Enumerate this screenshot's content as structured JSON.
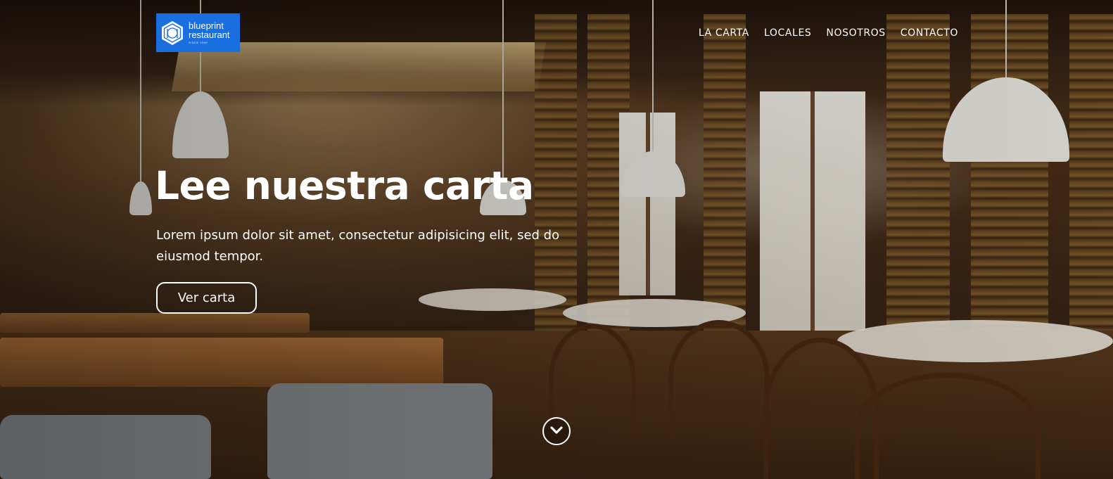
{
  "header": {
    "logo": {
      "line1": "blueprint",
      "line2": "restaurant",
      "line3": "SINCE 1990",
      "color": "#1a6fe0"
    },
    "nav": [
      "LA CARTA",
      "LOCALES",
      "NOSOTROS",
      "CONTACTO"
    ]
  },
  "hero": {
    "title": "Lee nuestra carta",
    "subtitle": "Lorem ipsum dolor sit amet, consectetur adipisicing elit, sed do eiusmod tempor.",
    "cta_label": "Ver carta",
    "background": "restaurant-interior-photo",
    "scroll_icon": "chevron-down-icon"
  }
}
